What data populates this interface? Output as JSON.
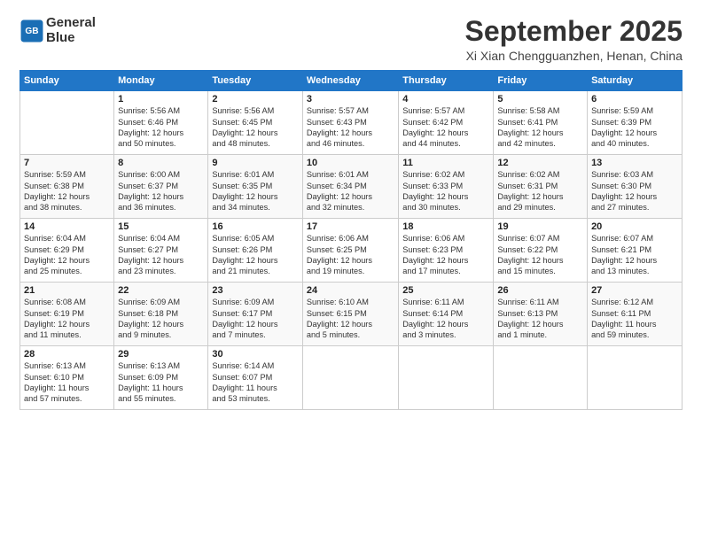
{
  "logo": {
    "line1": "General",
    "line2": "Blue"
  },
  "title": "September 2025",
  "location": "Xi Xian Chengguanzhen, Henan, China",
  "days_header": [
    "Sunday",
    "Monday",
    "Tuesday",
    "Wednesday",
    "Thursday",
    "Friday",
    "Saturday"
  ],
  "weeks": [
    [
      {
        "num": "",
        "info": ""
      },
      {
        "num": "1",
        "info": "Sunrise: 5:56 AM\nSunset: 6:46 PM\nDaylight: 12 hours\nand 50 minutes."
      },
      {
        "num": "2",
        "info": "Sunrise: 5:56 AM\nSunset: 6:45 PM\nDaylight: 12 hours\nand 48 minutes."
      },
      {
        "num": "3",
        "info": "Sunrise: 5:57 AM\nSunset: 6:43 PM\nDaylight: 12 hours\nand 46 minutes."
      },
      {
        "num": "4",
        "info": "Sunrise: 5:57 AM\nSunset: 6:42 PM\nDaylight: 12 hours\nand 44 minutes."
      },
      {
        "num": "5",
        "info": "Sunrise: 5:58 AM\nSunset: 6:41 PM\nDaylight: 12 hours\nand 42 minutes."
      },
      {
        "num": "6",
        "info": "Sunrise: 5:59 AM\nSunset: 6:39 PM\nDaylight: 12 hours\nand 40 minutes."
      }
    ],
    [
      {
        "num": "7",
        "info": "Sunrise: 5:59 AM\nSunset: 6:38 PM\nDaylight: 12 hours\nand 38 minutes."
      },
      {
        "num": "8",
        "info": "Sunrise: 6:00 AM\nSunset: 6:37 PM\nDaylight: 12 hours\nand 36 minutes."
      },
      {
        "num": "9",
        "info": "Sunrise: 6:01 AM\nSunset: 6:35 PM\nDaylight: 12 hours\nand 34 minutes."
      },
      {
        "num": "10",
        "info": "Sunrise: 6:01 AM\nSunset: 6:34 PM\nDaylight: 12 hours\nand 32 minutes."
      },
      {
        "num": "11",
        "info": "Sunrise: 6:02 AM\nSunset: 6:33 PM\nDaylight: 12 hours\nand 30 minutes."
      },
      {
        "num": "12",
        "info": "Sunrise: 6:02 AM\nSunset: 6:31 PM\nDaylight: 12 hours\nand 29 minutes."
      },
      {
        "num": "13",
        "info": "Sunrise: 6:03 AM\nSunset: 6:30 PM\nDaylight: 12 hours\nand 27 minutes."
      }
    ],
    [
      {
        "num": "14",
        "info": "Sunrise: 6:04 AM\nSunset: 6:29 PM\nDaylight: 12 hours\nand 25 minutes."
      },
      {
        "num": "15",
        "info": "Sunrise: 6:04 AM\nSunset: 6:27 PM\nDaylight: 12 hours\nand 23 minutes."
      },
      {
        "num": "16",
        "info": "Sunrise: 6:05 AM\nSunset: 6:26 PM\nDaylight: 12 hours\nand 21 minutes."
      },
      {
        "num": "17",
        "info": "Sunrise: 6:06 AM\nSunset: 6:25 PM\nDaylight: 12 hours\nand 19 minutes."
      },
      {
        "num": "18",
        "info": "Sunrise: 6:06 AM\nSunset: 6:23 PM\nDaylight: 12 hours\nand 17 minutes."
      },
      {
        "num": "19",
        "info": "Sunrise: 6:07 AM\nSunset: 6:22 PM\nDaylight: 12 hours\nand 15 minutes."
      },
      {
        "num": "20",
        "info": "Sunrise: 6:07 AM\nSunset: 6:21 PM\nDaylight: 12 hours\nand 13 minutes."
      }
    ],
    [
      {
        "num": "21",
        "info": "Sunrise: 6:08 AM\nSunset: 6:19 PM\nDaylight: 12 hours\nand 11 minutes."
      },
      {
        "num": "22",
        "info": "Sunrise: 6:09 AM\nSunset: 6:18 PM\nDaylight: 12 hours\nand 9 minutes."
      },
      {
        "num": "23",
        "info": "Sunrise: 6:09 AM\nSunset: 6:17 PM\nDaylight: 12 hours\nand 7 minutes."
      },
      {
        "num": "24",
        "info": "Sunrise: 6:10 AM\nSunset: 6:15 PM\nDaylight: 12 hours\nand 5 minutes."
      },
      {
        "num": "25",
        "info": "Sunrise: 6:11 AM\nSunset: 6:14 PM\nDaylight: 12 hours\nand 3 minutes."
      },
      {
        "num": "26",
        "info": "Sunrise: 6:11 AM\nSunset: 6:13 PM\nDaylight: 12 hours\nand 1 minute."
      },
      {
        "num": "27",
        "info": "Sunrise: 6:12 AM\nSunset: 6:11 PM\nDaylight: 11 hours\nand 59 minutes."
      }
    ],
    [
      {
        "num": "28",
        "info": "Sunrise: 6:13 AM\nSunset: 6:10 PM\nDaylight: 11 hours\nand 57 minutes."
      },
      {
        "num": "29",
        "info": "Sunrise: 6:13 AM\nSunset: 6:09 PM\nDaylight: 11 hours\nand 55 minutes."
      },
      {
        "num": "30",
        "info": "Sunrise: 6:14 AM\nSunset: 6:07 PM\nDaylight: 11 hours\nand 53 minutes."
      },
      {
        "num": "",
        "info": ""
      },
      {
        "num": "",
        "info": ""
      },
      {
        "num": "",
        "info": ""
      },
      {
        "num": "",
        "info": ""
      }
    ]
  ]
}
